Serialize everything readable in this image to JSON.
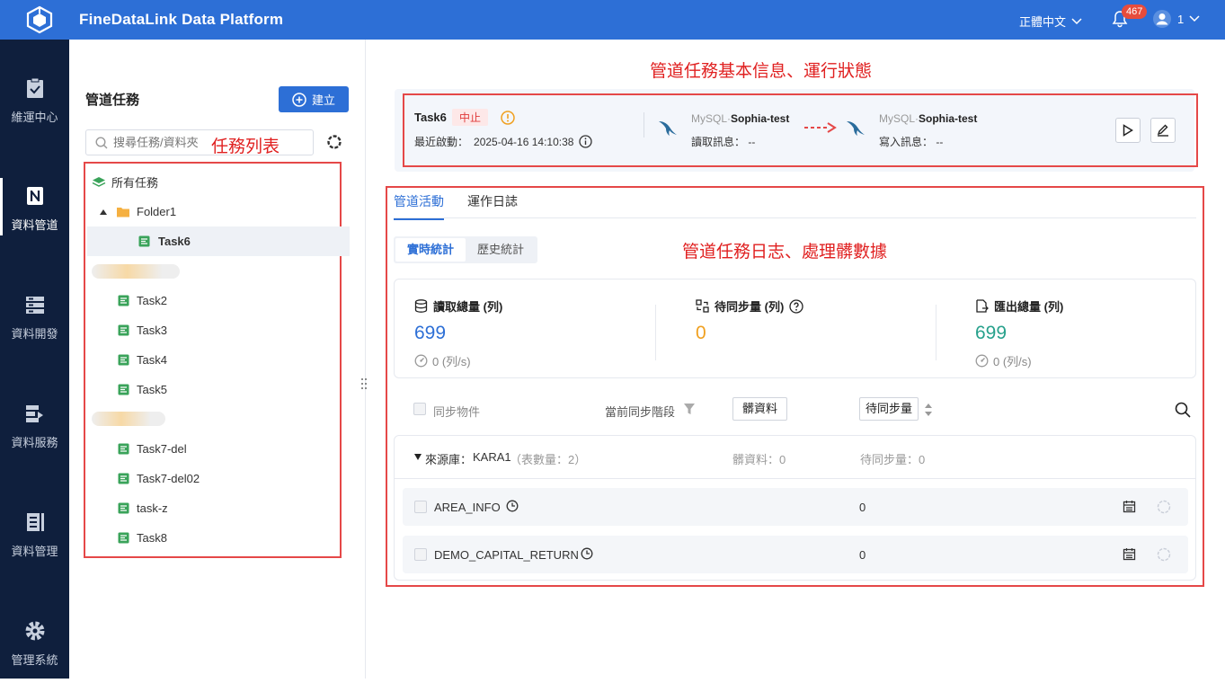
{
  "app": {
    "title": "FineDataLink Data Platform",
    "language": "正體中文",
    "notifications": "467",
    "user": "1"
  },
  "nav": [
    {
      "label": "維運中心",
      "icon": "clipboard-check-icon"
    },
    {
      "label": "資料管道",
      "icon": "pipeline-icon"
    },
    {
      "label": "資料開發",
      "icon": "server-stack-icon"
    },
    {
      "label": "資料服務",
      "icon": "data-service-icon"
    },
    {
      "label": "資料管理",
      "icon": "data-manage-icon"
    },
    {
      "label": "管理系統",
      "icon": "gear-icon"
    }
  ],
  "taskpane": {
    "title": "管道任務",
    "create_label": "建立",
    "search_placeholder": "搜尋任務/資料夾",
    "all_tasks": "所有任務",
    "folder": "Folder1",
    "items": [
      "Task6",
      "Task2",
      "Task3",
      "Task4",
      "Task5",
      "Task7-del",
      "Task7-del02",
      "task-z",
      "Task8"
    ]
  },
  "annotations": {
    "list": "任務列表",
    "info": "管道任務基本信息、運行狀態",
    "log": "管道任務日志、處理髒數據"
  },
  "task": {
    "name": "Task6",
    "status": "中止",
    "last_start_label": "最近啟動：",
    "last_start": "2025-04-16 14:10:38",
    "source": {
      "type": "MySQL·",
      "name": "Sophia-test",
      "msg_label": "讀取訊息：",
      "msg": "--"
    },
    "target": {
      "type": "MySQL·",
      "name": "Sophia-test",
      "msg_label": "寫入訊息：",
      "msg": "--"
    }
  },
  "tabs": [
    "管道活動",
    "運作日誌"
  ],
  "segments": [
    "實時統計",
    "歷史統計"
  ],
  "stats": [
    {
      "label": "讀取總量 (列)",
      "value": "699",
      "rate": "0 (列/s)",
      "color": "#2d6fd6"
    },
    {
      "label": "待同步量 (列)",
      "value": "0",
      "color": "#f0a020"
    },
    {
      "label": "匯出總量 (列)",
      "value": "699",
      "rate": "0 (列/s)",
      "color": "#27a18c"
    }
  ],
  "filters": {
    "sync_objects": "同步物件",
    "stage": "當前同步階段",
    "dirty": "髒資料",
    "pending": "待同步量"
  },
  "source_group": {
    "label": "來源庫：",
    "name": "KARA1",
    "table_count": "（表數量：2）",
    "dirty": "髒資料：0",
    "pending": "待同步量：0"
  },
  "rows": [
    {
      "name": "AREA_INFO",
      "pending": "0"
    },
    {
      "name": "DEMO_CAPITAL_RETURN",
      "pending": "0"
    }
  ]
}
